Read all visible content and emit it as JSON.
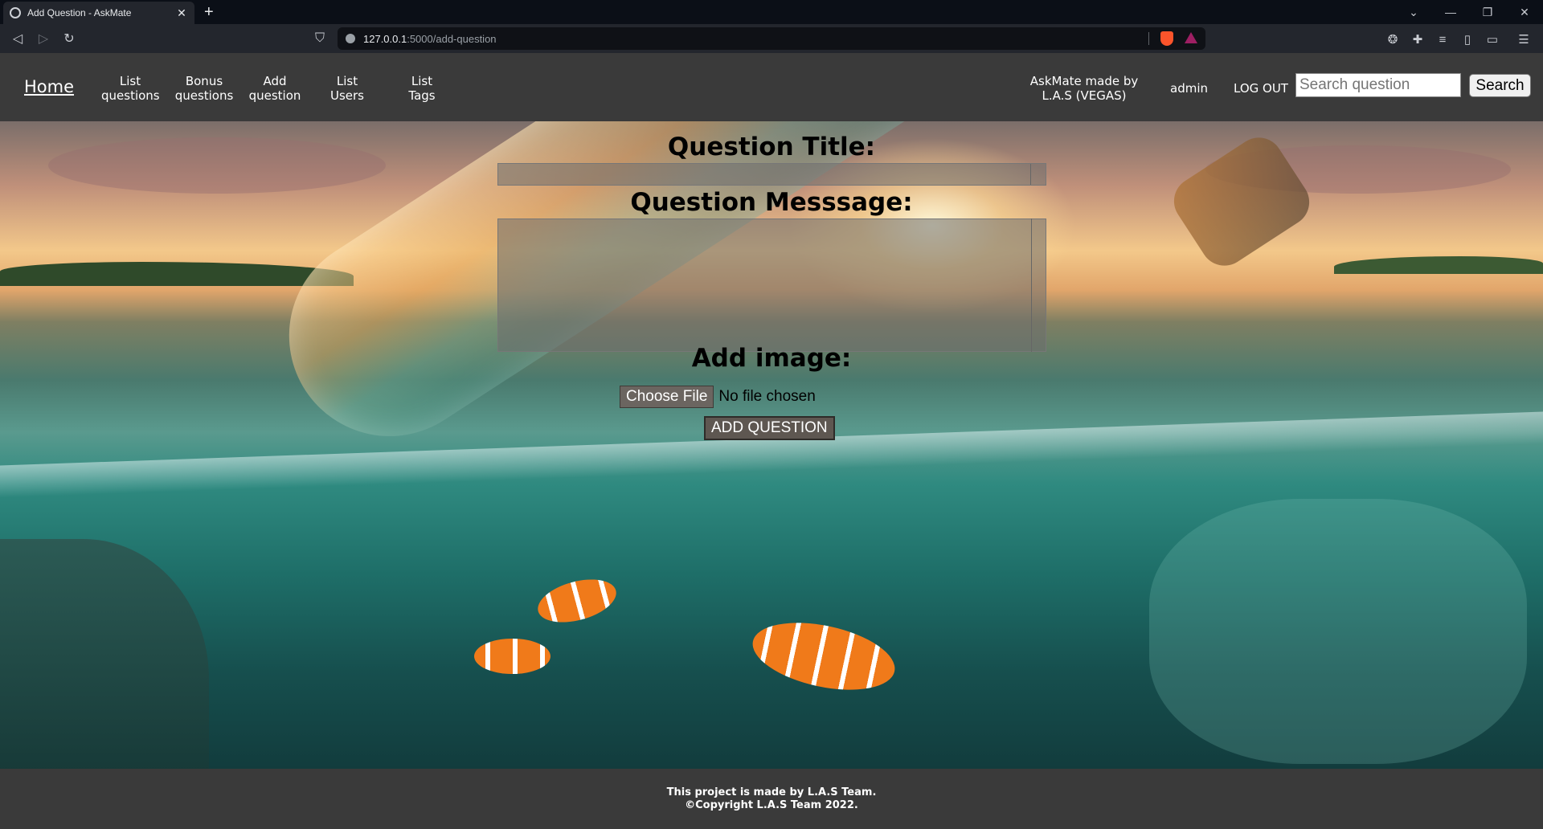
{
  "browser": {
    "tab_title": "Add Question - AskMate",
    "url_host": "127.0.0.1",
    "url_path": ":5000/add-question"
  },
  "nav": {
    "home": "Home",
    "links": [
      {
        "line1": "List",
        "line2": "questions"
      },
      {
        "line1": "Bonus",
        "line2": "questions"
      },
      {
        "line1": "Add",
        "line2": "question"
      },
      {
        "line1": "List",
        "line2": "Users"
      },
      {
        "line1": "List",
        "line2": "Tags"
      }
    ],
    "brand_line1": "AskMate made by",
    "brand_line2": "L.A.S (VEGAS)",
    "user": "admin",
    "logout": "LOG OUT",
    "search_placeholder": "Search question",
    "search_button": "Search"
  },
  "form": {
    "title_label": "Question Title:",
    "message_label": "Question Messsage:",
    "image_label": "Add image:",
    "file_button": "Choose File",
    "file_status": "No file chosen",
    "submit": "ADD QUESTION"
  },
  "footer": {
    "line1": "This project is made by L.A.S Team.",
    "line2": "©Copyright L.A.S Team 2022."
  }
}
